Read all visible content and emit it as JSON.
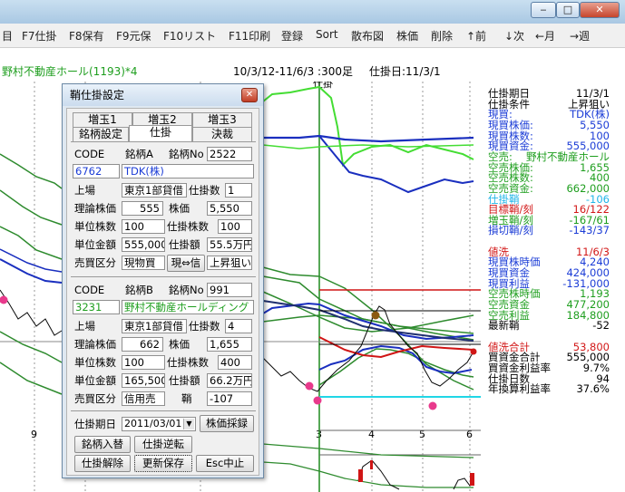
{
  "window": {
    "minimize": "‒",
    "maximize": "□",
    "close": "✕"
  },
  "menu": [
    "目",
    "F7仕掛",
    "F8保有",
    "F9元保",
    "F10リスト",
    "F11印刷",
    "登録",
    "Sort",
    "散布図",
    "株価",
    "削除",
    "↑前",
    "↓次",
    "←月",
    "→週"
  ],
  "chart_header": {
    "stock_name": "野村不動産ホール(1193)*4",
    "period": "10/3/12-11/6/3 :300足",
    "entry_date": "仕掛日:11/3/1",
    "entry_marker": "仕掛"
  },
  "chart_data": {
    "type": "line",
    "x_ticks": [
      "9",
      "1",
      "2",
      "3",
      "4",
      "5",
      "6"
    ],
    "upper_lines": [
      {
        "name": "",
        "color": "#44dd33"
      },
      {
        "name": "",
        "color": "#1a2fbf"
      },
      {
        "name": "",
        "color": "#1a2fbf"
      }
    ],
    "lower_lines": [
      {
        "name": "",
        "color": "#2e8b2e"
      },
      {
        "name": "",
        "color": "#1a2fbf"
      },
      {
        "name": "",
        "color": "#d01515"
      },
      {
        "name": "",
        "color": "#0a0a0a"
      }
    ],
    "marker_color": "#e83a8c",
    "entry_line_color": "#1f8b1f"
  },
  "info_panel": {
    "rows": [
      {
        "label": "仕掛期日",
        "value": "11/3/1",
        "color": "#000000"
      },
      {
        "label": "仕掛条件",
        "value": "上昇狙い",
        "color": "#000000"
      },
      {
        "label": "現買:",
        "value": "TDK(株)",
        "color": "#1b3cd6"
      },
      {
        "label": "現買株価:",
        "value": "5,550",
        "color": "#1b3cd6"
      },
      {
        "label": "現買株数:",
        "value": "100",
        "color": "#1b3cd6"
      },
      {
        "label": "現買資金:",
        "value": "555,000",
        "color": "#1b3cd6"
      },
      {
        "label": "空売:",
        "value": "野村不動産ホール",
        "color": "#1e9e1e"
      },
      {
        "label": "空売株価:",
        "value": "1,655",
        "color": "#1e9e1e"
      },
      {
        "label": "空売株数:",
        "value": "400",
        "color": "#1e9e1e"
      },
      {
        "label": "空売資金:",
        "value": "662,000",
        "color": "#1e9e1e"
      },
      {
        "label": "仕掛鞘",
        "value": "-106",
        "color": "#21b5e8"
      },
      {
        "label": "目標鞘/刻",
        "value": "16/122",
        "color": "#d21818"
      },
      {
        "label": "増玉鞘/刻",
        "value": "-167/61",
        "color": "#1e9e1e"
      },
      {
        "label": "損切鞘/刻",
        "value": "-143/37",
        "color": "#1b3cd6"
      },
      {
        "label": "",
        "value": "",
        "color": "#000000"
      },
      {
        "label": "値洗",
        "value": "11/6/3",
        "color": "#d21818"
      },
      {
        "label": "現買株時価",
        "value": "4,240",
        "color": "#1b3cd6"
      },
      {
        "label": "現買資金",
        "value": "424,000",
        "color": "#1b3cd6"
      },
      {
        "label": "現買利益",
        "value": "-131,000",
        "color": "#1b3cd6"
      },
      {
        "label": "空売株時価",
        "value": "1,193",
        "color": "#1e9e1e"
      },
      {
        "label": "空売資金",
        "value": "477,200",
        "color": "#1e9e1e"
      },
      {
        "label": "空売利益",
        "value": "184,800",
        "color": "#1e9e1e"
      },
      {
        "label": "最新鞘",
        "value": "-52",
        "color": "#000000"
      },
      {
        "label": "",
        "value": "",
        "color": "#000000"
      },
      {
        "label": "値洗合計",
        "value": "53,800",
        "color": "#d21818"
      },
      {
        "label": "買資金合計",
        "value": "555,000",
        "color": "#000000"
      },
      {
        "label": "買資金利益率",
        "value": "9.7%",
        "color": "#000000"
      },
      {
        "label": "仕掛日数",
        "value": "94",
        "color": "#000000"
      },
      {
        "label": "年換算利益率",
        "value": "37.6%",
        "color": "#000000"
      }
    ]
  },
  "dialog": {
    "title": "鞘仕掛設定",
    "close": "✕",
    "tabs_row1": [
      "増玉1",
      "増玉2",
      "増玉3"
    ],
    "tabs_row2": [
      "銘柄設定",
      "仕掛",
      "決裁"
    ],
    "stock_a": {
      "code_label": "CODE",
      "code": "6762",
      "name_label": "銘柄A",
      "no_label": "銘柄No",
      "no": "2522",
      "name": "TDK(株)",
      "market_label": "上場",
      "market": "東京1部貸借",
      "count_label": "仕掛数",
      "count": "1",
      "theory_label": "理論株価",
      "theory": "555",
      "price_label": "株価",
      "price": "5,550",
      "unit_label": "単位株数",
      "unit": "100",
      "shares_label": "仕掛株数",
      "shares": "100",
      "unit_amount_label": "単位金額",
      "unit_amount": "555,000",
      "amount_label": "仕掛額",
      "amount": "55.5万円",
      "trade_label": "売買区分",
      "trade": "現物買",
      "toggle": "現⇔信",
      "condition": "上昇狙い"
    },
    "stock_b": {
      "code_label": "CODE",
      "code": "3231",
      "name_label": "銘柄B",
      "no_label": "銘柄No",
      "no": "991",
      "name": "野村不動産ホールディング",
      "market_label": "上場",
      "market": "東京1部貸借",
      "count_label": "仕掛数",
      "count": "4",
      "theory_label": "理論株価",
      "theory": "662",
      "price_label": "株価",
      "price": "1,655",
      "unit_label": "単位株数",
      "unit": "100",
      "shares_label": "仕掛株数",
      "shares": "400",
      "unit_amount_label": "単位金額",
      "unit_amount": "165,500",
      "amount_label": "仕掛額",
      "amount": "66.2万円",
      "trade_label": "売買区分",
      "trade": "信用売",
      "spread_label": "鞘",
      "spread": "-107"
    },
    "date_label": "仕掛期日",
    "date": "2011/03/01",
    "adopt_button": "株価採録",
    "swap_button": "銘柄入替",
    "reverse_button": "仕掛逆転",
    "cancel_button": "仕掛解除",
    "save_button": "更新保存",
    "esc_button": "Esc中止"
  }
}
